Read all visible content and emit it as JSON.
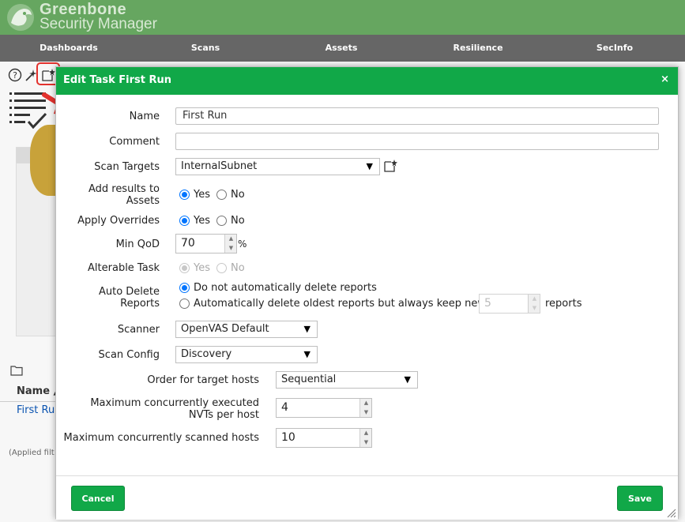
{
  "app": {
    "brand_line1": "Greenbone",
    "brand_line2": "Security Manager"
  },
  "nav": [
    "Dashboards",
    "Scans",
    "Assets",
    "Resilience",
    "SecInfo"
  ],
  "toolbar": {
    "help_icon": "help-icon",
    "wizard_icon": "wizard-icon",
    "new_task_icon": "new-task-icon"
  },
  "background": {
    "table_header": "Name ▲",
    "task_link": "First Run",
    "applied_filter": "(Applied filt"
  },
  "modal": {
    "title": "Edit Task First Run",
    "close": "×",
    "name": {
      "label": "Name",
      "value": "First Run"
    },
    "comment": {
      "label": "Comment",
      "value": ""
    },
    "scan_targets": {
      "label": "Scan Targets",
      "value": "InternalSubnet"
    },
    "add_results": {
      "label_line1": "Add results to",
      "label_line2": "Assets",
      "yes": "Yes",
      "no": "No",
      "selected": "Yes"
    },
    "apply_overrides": {
      "label": "Apply Overrides",
      "yes": "Yes",
      "no": "No",
      "selected": "Yes"
    },
    "min_qod": {
      "label": "Min QoD",
      "value": "70",
      "unit": "%"
    },
    "alterable_task": {
      "label": "Alterable Task",
      "yes": "Yes",
      "no": "No",
      "selected": "Yes"
    },
    "auto_delete": {
      "label_line1": "Auto Delete",
      "label_line2": "Reports",
      "option_none": "Do not automatically delete reports",
      "option_keep": "Automatically delete oldest reports but always keep newest",
      "keep_value": "5",
      "keep_suffix": "reports",
      "selected": "none"
    },
    "scanner": {
      "label": "Scanner",
      "value": "OpenVAS Default"
    },
    "scan_config": {
      "label": "Scan Config",
      "value": "Discovery"
    },
    "order_hosts": {
      "label": "Order for target hosts",
      "value": "Sequential"
    },
    "max_nvts": {
      "label_line1": "Maximum concurrently executed",
      "label_line2": "NVTs per host",
      "value": "4"
    },
    "max_hosts": {
      "label": "Maximum concurrently scanned hosts",
      "value": "10"
    },
    "cancel_label": "Cancel",
    "save_label": "Save"
  },
  "colors": {
    "header_green": "#66a660",
    "modal_green": "#11a848",
    "nav_gray": "#666666",
    "highlight_red": "#e3322e"
  }
}
